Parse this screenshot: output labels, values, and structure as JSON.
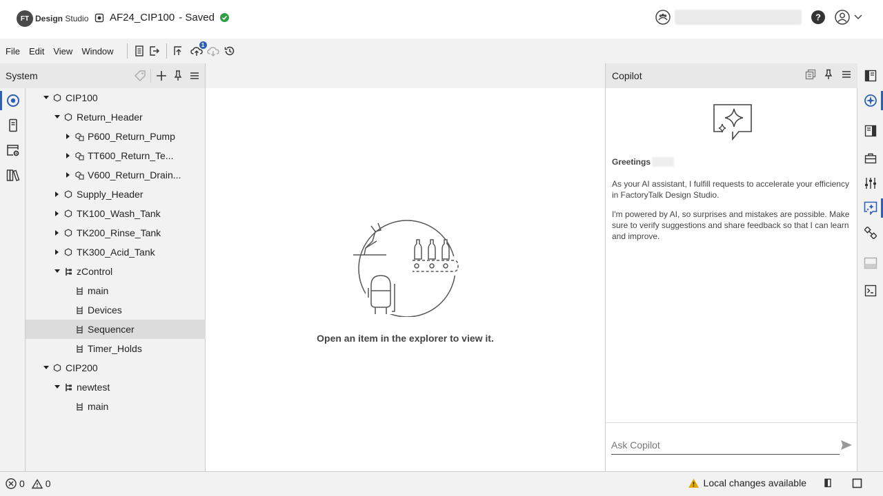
{
  "app": {
    "logo_badge": "FT",
    "logo_bold": "Design",
    "logo_rest": " Studio",
    "project_name": "AF24_CIP100",
    "save_status": "- Saved"
  },
  "menu": {
    "file": "File",
    "edit": "Edit",
    "view": "View",
    "window": "Window",
    "upload_badge": "1"
  },
  "system_panel": {
    "title": "System",
    "tree": [
      {
        "label": "CIP100",
        "level": 0,
        "expanded": true,
        "icon": "hexagon-icon"
      },
      {
        "label": "Return_Header",
        "level": 1,
        "expanded": true,
        "icon": "hexagon-icon"
      },
      {
        "label": "P600_Return_Pump",
        "level": 2,
        "expanded": false,
        "icon": "device-icon"
      },
      {
        "label": "TT600_Return_Te...",
        "level": 2,
        "expanded": false,
        "icon": "device-icon"
      },
      {
        "label": "V600_Return_Drain...",
        "level": 2,
        "expanded": false,
        "icon": "device-icon"
      },
      {
        "label": "Supply_Header",
        "level": 1,
        "expanded": false,
        "icon": "hexagon-icon"
      },
      {
        "label": "TK100_Wash_Tank",
        "level": 1,
        "expanded": false,
        "icon": "hexagon-icon"
      },
      {
        "label": "TK200_Rinse_Tank",
        "level": 1,
        "expanded": false,
        "icon": "hexagon-icon"
      },
      {
        "label": "TK300_Acid_Tank",
        "level": 1,
        "expanded": false,
        "icon": "hexagon-icon"
      },
      {
        "label": "zControl",
        "level": 1,
        "expanded": true,
        "icon": "controller-icon"
      },
      {
        "label": "main",
        "level": 2,
        "leaf": true,
        "icon": "ladder-icon"
      },
      {
        "label": "Devices",
        "level": 2,
        "leaf": true,
        "icon": "ladder-icon"
      },
      {
        "label": "Sequencer",
        "level": 2,
        "leaf": true,
        "icon": "ladder-icon",
        "selected": true
      },
      {
        "label": "Timer_Holds",
        "level": 2,
        "leaf": true,
        "icon": "ladder-icon"
      },
      {
        "label": "CIP200",
        "level": 0,
        "expanded": true,
        "icon": "hexagon-icon"
      },
      {
        "label": "newtest",
        "level": 1,
        "expanded": true,
        "icon": "controller-icon"
      },
      {
        "label": "main",
        "level": 2,
        "leaf": true,
        "icon": "ladder-icon"
      }
    ]
  },
  "main": {
    "empty_message": "Open an item in the explorer to view it."
  },
  "copilot": {
    "title": "Copilot",
    "greeting": "Greetings",
    "para1": "As your AI assistant, I fulfill requests to accelerate your efficiency in FactoryTalk Design Studio.",
    "para2": "I'm powered by AI, so surprises and mistakes are possible. Make sure to verify suggestions and share feedback so that I can learn and improve.",
    "input_placeholder": "Ask Copilot"
  },
  "status": {
    "errors": "0",
    "warnings": "0",
    "local_changes": "Local changes available"
  },
  "colors": {
    "accent": "#2c5fb5",
    "saved": "#2e9e44",
    "warning": "#e0a800"
  }
}
